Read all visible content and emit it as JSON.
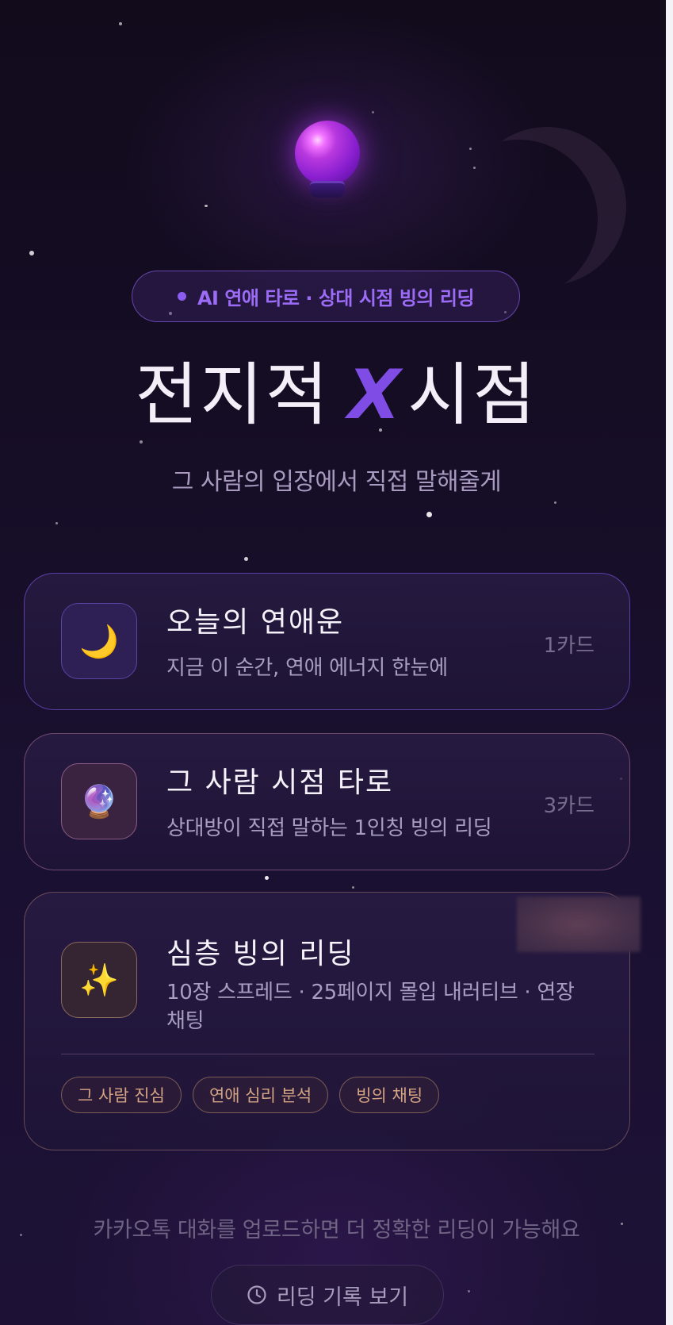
{
  "header": {
    "orb_icon": "crystal-ball-icon",
    "badge_text": "AI 연애 타로 · 상대 시점 빙의 리딩",
    "title_left": "전지적",
    "title_x": "X",
    "title_right": "시점",
    "subtitle": "그 사람의 입장에서 직접 말해줄게"
  },
  "menu": {
    "items": [
      {
        "icon": "crescent-moon-icon",
        "glyph": "🌙",
        "title": "오늘의 연애운",
        "description": "지금 이 순간, 연애 에너지 한눈에",
        "count": "1카드"
      },
      {
        "icon": "crystal-ball-icon",
        "glyph": "🔮",
        "title": "그 사람 시점 타로",
        "description": "상대방이 직접 말하는 1인칭 빙의 리딩",
        "count": "3카드"
      },
      {
        "icon": "sparkles-icon",
        "glyph": "✨",
        "title": "심층 빙의 리딩",
        "description": "10장 스프레드 · 25페이지 몰입 내러티브 · 연장 채팅",
        "tags": [
          "그 사람 진심",
          "연애 심리 분석",
          "빙의 채팅"
        ]
      }
    ]
  },
  "footer": {
    "upload_hint": "카카오톡 대화를 업로드하면 더 정확한 리딩이 가능해요",
    "history_button": "리딩 기록 보기",
    "history_icon": "clock-icon"
  },
  "colors": {
    "accent_purple": "#8c5cf0",
    "background": "#150d24",
    "tag_text": "#d3a384"
  }
}
